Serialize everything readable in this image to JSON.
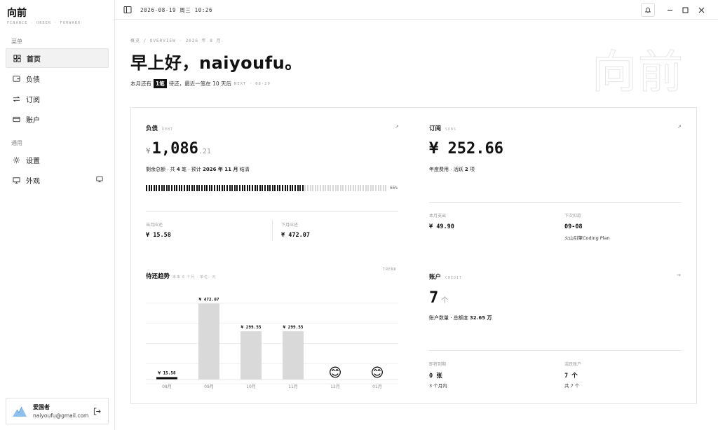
{
  "app": {
    "brand": "向前",
    "brand_sub": "FINANCE · ORDER · FORWARD"
  },
  "sidebar": {
    "menu_label": "菜单",
    "items": [
      {
        "label": "首页",
        "icon": "dashboard-icon",
        "active": true
      },
      {
        "label": "负债",
        "icon": "wallet-icon"
      },
      {
        "label": "订阅",
        "icon": "repeat-icon"
      },
      {
        "label": "账户",
        "icon": "card-icon"
      }
    ],
    "general_label": "通用",
    "general_items": [
      {
        "label": "设置",
        "icon": "gear-icon"
      },
      {
        "label": "外观",
        "icon": "monitor-icon"
      }
    ],
    "user": {
      "name": "爱国者",
      "email": "naiyoufu@gmail.com"
    }
  },
  "topbar": {
    "datetime": "2026-08-19 周三 10:26"
  },
  "header": {
    "breadcrumb": "概览 / OVERVIEW · 2026 年 8 月",
    "greeting": "早上好，naiyoufu。",
    "reminder_pre": "本月还有",
    "reminder_pill": "1笔",
    "reminder_post": "待还，最近一笔在 10 天后",
    "reminder_next": "NEXT · 08-29",
    "watermark": "向前"
  },
  "debt": {
    "title": "负债",
    "title_en": "DEBT",
    "arrow": "↗",
    "currency": "¥",
    "amount_int": "1,086",
    "amount_dec": ".21",
    "summary_pre": "剩余总额 · 共",
    "summary_count": "4",
    "summary_mid": "笔 · 预计",
    "summary_date": "2026 年 11 月",
    "summary_post": "结清",
    "progress_pct": "66%",
    "progress_value": 0.66,
    "stat1_label": "当月应还",
    "stat1_value": "¥ 15.58",
    "stat2_label": "下月应还",
    "stat2_value": "¥ 472.07"
  },
  "subs": {
    "title": "订阅",
    "title_en": "SUBS",
    "arrow": "↗",
    "amount": "¥ 252.66",
    "summary_pre": "年度费用 · 活跃",
    "summary_count": "2",
    "summary_post": "项",
    "stat1_label": "本月支出",
    "stat1_value": "¥ 49.90",
    "stat2_label": "下次扣款",
    "stat2_value": "09-08",
    "stat2_sub": "火山引擎Coding Plan"
  },
  "accounts": {
    "title": "账户",
    "title_en": "CREDIT",
    "arrow": "→",
    "count": "7",
    "unit": "个",
    "summary_pre": "账户数量 · 总额度",
    "summary_value": "32.65 万",
    "stat1_label": "即将到期",
    "stat1_value": "0 张",
    "stat1_sub": "3 个月内",
    "stat2_label": "活跃账户",
    "stat2_value": "7 个",
    "stat2_sub": "共 7 个"
  },
  "trend": {
    "title": "待还趋势",
    "subtitle": "未来 6 个月 · 单位：元",
    "tag": "TREND"
  },
  "chart_data": {
    "type": "bar",
    "categories": [
      "08月",
      "09月",
      "10月",
      "11月",
      "12月",
      "01月"
    ],
    "values": [
      15.58,
      472.07,
      299.55,
      299.55,
      0,
      0
    ],
    "labels": [
      "¥ 15.58",
      "¥ 472.07",
      "¥ 299.55",
      "¥ 299.55",
      "",
      ""
    ],
    "empty_icon": "😊",
    "ylim": [
      0,
      500
    ],
    "grid": true,
    "colors": {
      "current": "#111111",
      "bar": "#d9d9d9"
    }
  }
}
